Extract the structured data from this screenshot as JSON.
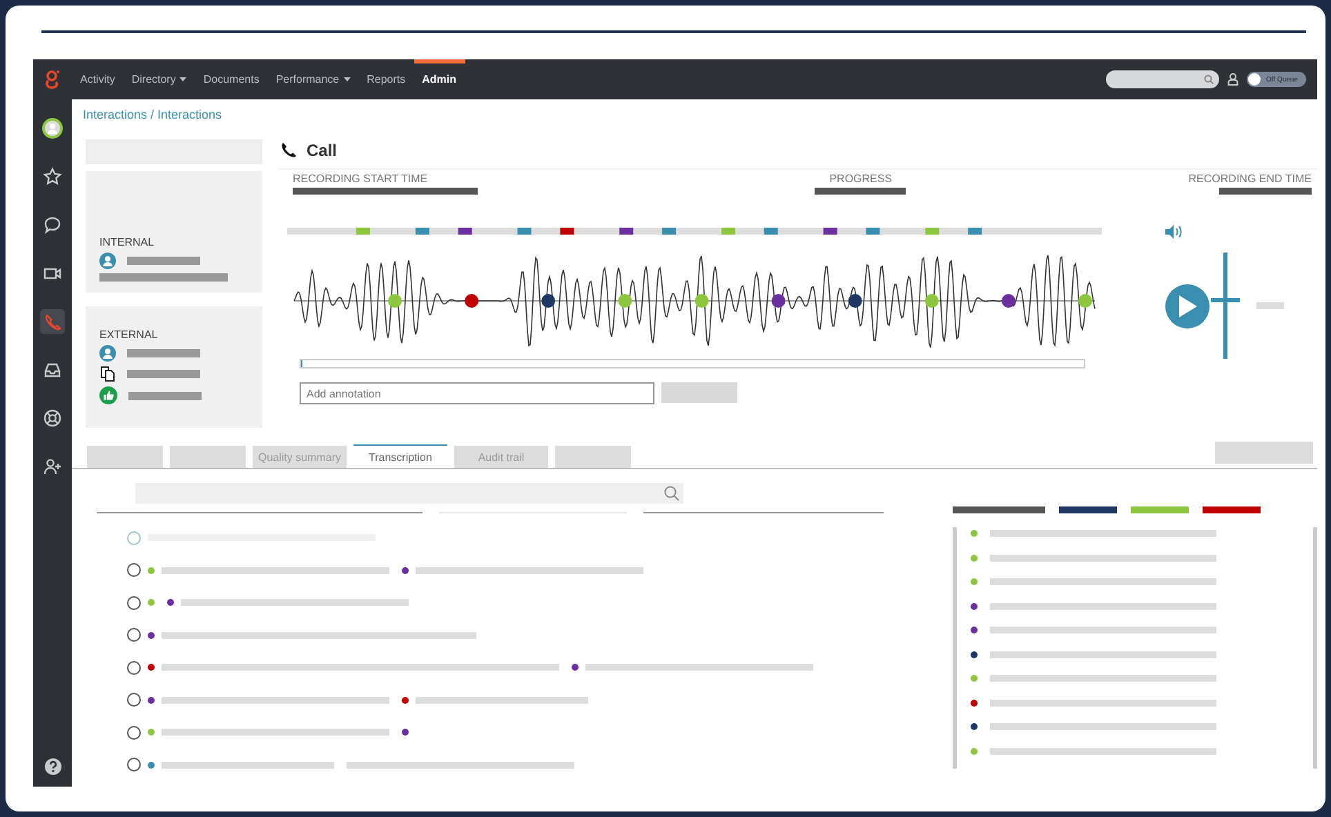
{
  "nav": {
    "items": [
      {
        "label": "Activity",
        "dropdown": false,
        "selected": false
      },
      {
        "label": "Directory",
        "dropdown": true,
        "selected": false
      },
      {
        "label": "Documents",
        "dropdown": false,
        "selected": false
      },
      {
        "label": "Performance",
        "dropdown": true,
        "selected": false
      },
      {
        "label": "Reports",
        "dropdown": false,
        "selected": false
      },
      {
        "label": "Admin",
        "dropdown": false,
        "selected": true
      }
    ],
    "queue_toggle": {
      "label": "Off Queue",
      "on": false
    }
  },
  "sidebar": {
    "items": [
      {
        "kind": "avatar",
        "selected": false
      },
      {
        "kind": "star",
        "selected": false
      },
      {
        "kind": "chat",
        "selected": false
      },
      {
        "kind": "video",
        "selected": false
      },
      {
        "kind": "phone",
        "selected": true
      },
      {
        "kind": "inbox",
        "selected": false
      },
      {
        "kind": "support",
        "selected": false
      },
      {
        "kind": "user-add",
        "selected": false
      },
      {
        "kind": "help",
        "selected": false
      }
    ]
  },
  "breadcrumb": "Interactions / Interactions",
  "title": "Call",
  "participants": [
    {
      "heading": "INTERNAL",
      "rows": [
        {
          "kind": "avatar"
        },
        {
          "kind": "plain"
        }
      ]
    },
    {
      "heading": "EXTERNAL",
      "rows": [
        {
          "kind": "avatar"
        },
        {
          "kind": "copy"
        },
        {
          "kind": "thumb"
        }
      ]
    }
  ],
  "recording": {
    "start_label": "RECORDING START TIME",
    "progress_label": "PROGRESS",
    "end_label": "RECORDING END TIME",
    "markers": [
      {
        "color": "#8dc63f"
      },
      {
        "color": "#3a8fb0"
      },
      {
        "color": "#6b2fa0"
      },
      {
        "color": "#3a8fb0"
      },
      {
        "color": "#c00000"
      },
      {
        "color": "#6b2fa0"
      },
      {
        "color": "#3a8fb0"
      },
      {
        "color": "#8dc63f"
      },
      {
        "color": "#3a8fb0"
      },
      {
        "color": "#6b2fa0"
      },
      {
        "color": "#3a8fb0"
      },
      {
        "color": "#8dc63f"
      },
      {
        "color": "#3a8fb0"
      }
    ],
    "points": [
      {
        "color": "#8dc63f"
      },
      {
        "color": "#c00000"
      },
      {
        "color": "#1f3864"
      },
      {
        "color": "#8dc63f"
      },
      {
        "color": "#8dc63f"
      },
      {
        "color": "#6b2fa0"
      },
      {
        "color": "#1f3864"
      },
      {
        "color": "#8dc63f"
      },
      {
        "color": "#6b2fa0"
      },
      {
        "color": "#8dc63f"
      }
    ],
    "volume": {
      "level": 0.55
    },
    "progress": {
      "level": 0
    },
    "annotation": {
      "placeholder": "Add annotation"
    }
  },
  "tabs": [
    {
      "selected": false
    },
    {
      "selected": false
    },
    {
      "label": "Quality summary",
      "selected": false
    },
    {
      "label": "Transcription",
      "selected": true
    },
    {
      "label": "Audit trail",
      "selected": false
    },
    {
      "selected": false
    }
  ],
  "transcript": [
    {
      "kind": "faint",
      "selected": false,
      "segments": [
        {
          "kind": "bar"
        }
      ]
    },
    {
      "kind": "line",
      "selected": false,
      "segments": [
        {
          "kind": "dot-bar",
          "color": "#8dc63f"
        },
        {
          "kind": "dot-bar",
          "color": "#6b2fa0"
        }
      ]
    },
    {
      "kind": "line",
      "selected": false,
      "segments": [
        {
          "kind": "dot",
          "color": "#8dc63f"
        },
        {
          "kind": "dot-bar",
          "color": "#6b2fa0"
        }
      ]
    },
    {
      "kind": "line",
      "selected": false,
      "segments": [
        {
          "kind": "dot-bar",
          "color": "#6b2fa0"
        }
      ]
    },
    {
      "kind": "line",
      "selected": false,
      "segments": [
        {
          "kind": "dot-bar",
          "color": "#c00000"
        },
        {
          "kind": "dot-bar",
          "color": "#6b2fa0"
        }
      ]
    },
    {
      "kind": "line",
      "selected": false,
      "segments": [
        {
          "kind": "dot-bar",
          "color": "#6b2fa0"
        },
        {
          "kind": "dot-bar",
          "color": "#c00000"
        }
      ]
    },
    {
      "kind": "line",
      "selected": false,
      "segments": [
        {
          "kind": "dot-bar",
          "color": "#8dc63f"
        },
        {
          "kind": "dot",
          "color": "#6b2fa0"
        }
      ]
    },
    {
      "kind": "line",
      "selected": false,
      "segments": [
        {
          "kind": "dot-bar",
          "color": "#3a8fb0"
        },
        {
          "kind": "bar"
        }
      ]
    }
  ],
  "legend": [
    {
      "color": "#555555"
    },
    {
      "color": "#1f3864"
    },
    {
      "color": "#8dc63f"
    },
    {
      "color": "#c00000"
    }
  ],
  "side_list": [
    {
      "color": "#8dc63f"
    },
    {
      "color": "#8dc63f"
    },
    {
      "color": "#8dc63f"
    },
    {
      "color": "#6b2fa0"
    },
    {
      "color": "#6b2fa0"
    },
    {
      "color": "#1f3864"
    },
    {
      "color": "#8dc63f"
    },
    {
      "color": "#c00000"
    },
    {
      "color": "#1f3864"
    },
    {
      "color": "#8dc63f"
    }
  ]
}
